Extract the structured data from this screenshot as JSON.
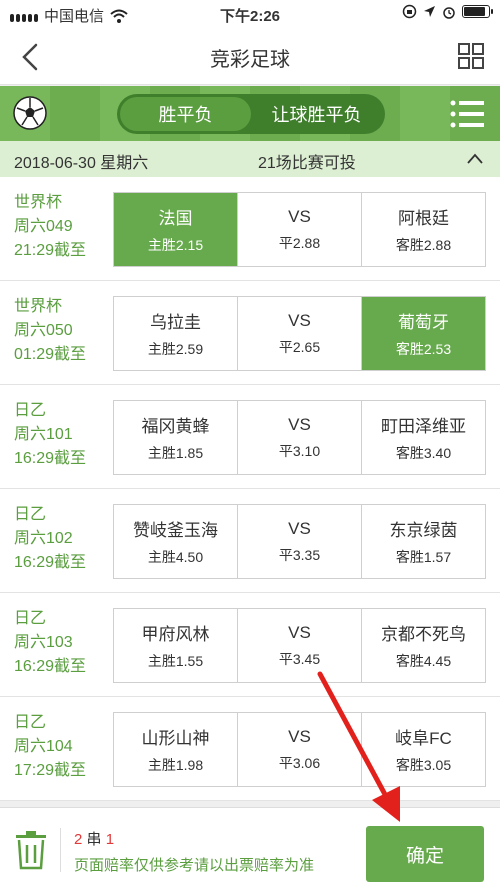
{
  "status": {
    "carrier": "中国电信",
    "time": "下午2:26"
  },
  "nav": {
    "title": "竞彩足球"
  },
  "tabs": [
    {
      "label": "胜平负",
      "active": true
    },
    {
      "label": "让球胜平负",
      "active": false
    }
  ],
  "date_bar": {
    "date": "2018-06-30 星期六",
    "count": "21场比赛可投"
  },
  "matches": [
    {
      "league": "世界杯",
      "code": "周六049",
      "deadline": "21:29截至",
      "home": "法国",
      "home_odds": "主胜2.15",
      "vs": "VS",
      "draw_odds": "平2.88",
      "away": "阿根廷",
      "away_odds": "客胜2.88",
      "selected": "home"
    },
    {
      "league": "世界杯",
      "code": "周六050",
      "deadline": "01:29截至",
      "home": "乌拉圭",
      "home_odds": "主胜2.59",
      "vs": "VS",
      "draw_odds": "平2.65",
      "away": "葡萄牙",
      "away_odds": "客胜2.53",
      "selected": "away"
    },
    {
      "league": "日乙",
      "code": "周六101",
      "deadline": "16:29截至",
      "home": "福冈黄蜂",
      "home_odds": "主胜1.85",
      "vs": "VS",
      "draw_odds": "平3.10",
      "away": "町田泽维亚",
      "away_odds": "客胜3.40",
      "selected": ""
    },
    {
      "league": "日乙",
      "code": "周六102",
      "deadline": "16:29截至",
      "home": "赞岐釜玉海",
      "home_odds": "主胜4.50",
      "vs": "VS",
      "draw_odds": "平3.35",
      "away": "东京绿茵",
      "away_odds": "客胜1.57",
      "selected": ""
    },
    {
      "league": "日乙",
      "code": "周六103",
      "deadline": "16:29截至",
      "home": "甲府风林",
      "home_odds": "主胜1.55",
      "vs": "VS",
      "draw_odds": "平3.45",
      "away": "京都不死鸟",
      "away_odds": "客胜4.45",
      "selected": ""
    },
    {
      "league": "日乙",
      "code": "周六104",
      "deadline": "17:29截至",
      "home": "山形山神",
      "home_odds": "主胜1.98",
      "vs": "VS",
      "draw_odds": "平3.06",
      "away": "岐阜FC",
      "away_odds": "客胜3.05",
      "selected": ""
    }
  ],
  "bottom": {
    "bet_count": "2",
    "bet_unit": "串",
    "bet_mult": "1",
    "note": "页面赔率仅供参考请以出票赔率为准",
    "confirm_label": "确定"
  },
  "colors": {
    "accent": "#67aa4d",
    "highlight": "#e03a3a",
    "arrow": "#e3211c"
  }
}
